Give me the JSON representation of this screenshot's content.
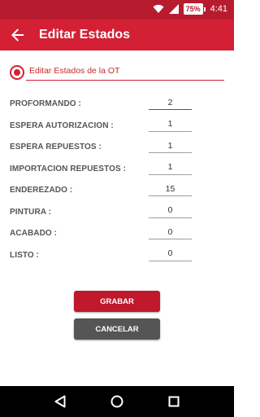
{
  "status_bar": {
    "battery": "75%",
    "time": "4:41"
  },
  "app_bar": {
    "title": "Editar Estados"
  },
  "ot_option": {
    "label": "Editar Estados de la OT"
  },
  "fields": [
    {
      "label": "PROFORMANDO :",
      "value": "2"
    },
    {
      "label": "ESPERA AUTORIZACION :",
      "value": "1"
    },
    {
      "label": "ESPERA REPUESTOS :",
      "value": "1"
    },
    {
      "label": "IMPORTACION REPUESTOS :",
      "value": "1"
    },
    {
      "label": "ENDEREZADO :",
      "value": "15"
    },
    {
      "label": "PINTURA :",
      "value": "0"
    },
    {
      "label": "ACABADO :",
      "value": "0"
    },
    {
      "label": "LISTO :",
      "value": "0"
    }
  ],
  "buttons": {
    "save": "GRABAR",
    "cancel": "CANCELAR"
  },
  "colors": {
    "primary": "#d32035",
    "status_bar": "#b71c2e",
    "cancel": "#555555"
  },
  "icons": {
    "back": "arrow-left-icon",
    "radio": "radio-checked-icon",
    "nav_back": "triangle-back-icon",
    "nav_home": "circle-home-icon",
    "nav_recent": "square-recents-icon"
  }
}
